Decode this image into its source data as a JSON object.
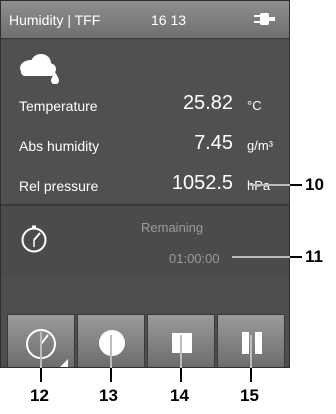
{
  "status_bar": {
    "title": "Humidity | TFF",
    "time": "16 13",
    "power_icon": "power-plug-icon"
  },
  "readings": {
    "weather_icon": "cloud-drop-icon",
    "rows": [
      {
        "label": "Temperature",
        "value": "25.82",
        "unit": "°C"
      },
      {
        "label": "Abs humidity",
        "value": "7.45",
        "unit": "g/m³"
      },
      {
        "label": "Rel pressure",
        "value": "1052.5",
        "unit": "hPa"
      }
    ]
  },
  "timer": {
    "icon": "stopwatch-icon",
    "remaining_label": "Remaining",
    "remaining_value": "01:00:00"
  },
  "toolbar": {
    "buttons": [
      {
        "name": "timer-settings",
        "icon": "stopwatch-icon"
      },
      {
        "name": "record",
        "icon": "record-circle-icon"
      },
      {
        "name": "stop",
        "icon": "stop-square-icon"
      },
      {
        "name": "pause",
        "icon": "pause-icon"
      }
    ]
  },
  "callouts": {
    "n10": "10",
    "n11": "11",
    "n12": "12",
    "n13": "13",
    "n14": "14",
    "n15": "15"
  },
  "colors": {
    "panel": "#4b4b4b",
    "status_bar": "#7f7f7f",
    "text": "#ffffff",
    "muted_text": "#9a9a9a"
  }
}
